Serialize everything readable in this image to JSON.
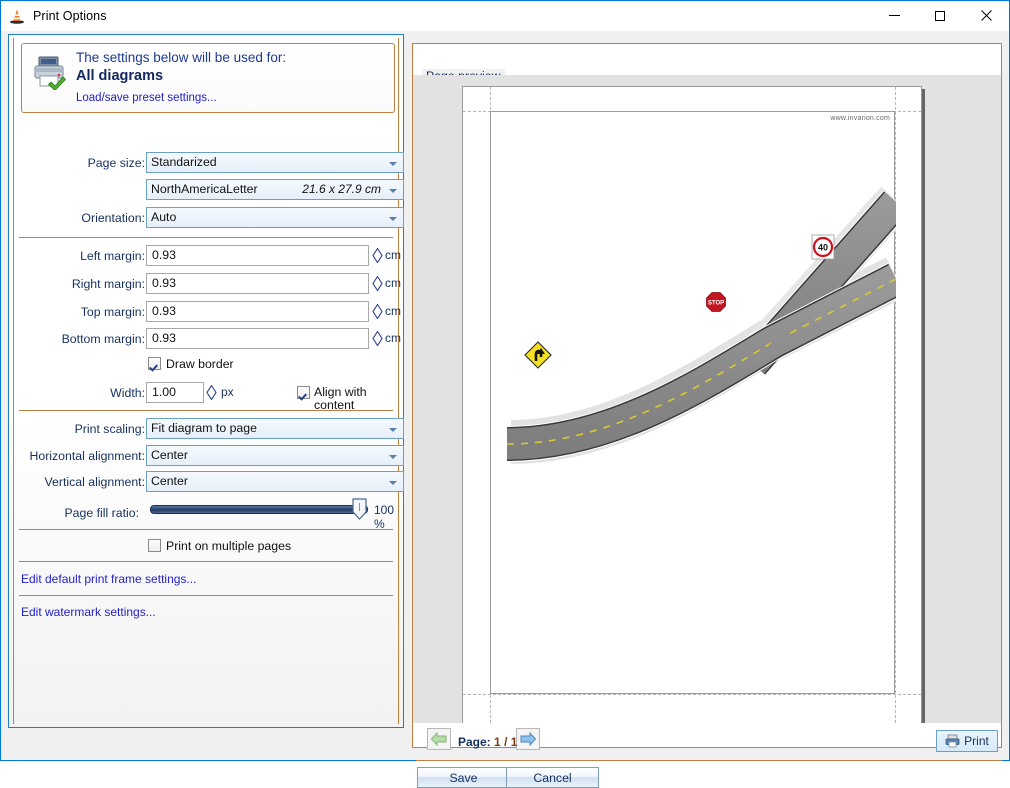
{
  "window": {
    "title": "Print Options",
    "icon": "traffic-cone-icon",
    "minimize_label": "Minimize",
    "maximize_label": "Maximize",
    "close_label": "Close"
  },
  "preset": {
    "icon": "printer-check-icon",
    "line1": "The settings below will be used for:",
    "line2": "All diagrams",
    "link": "Load/save preset settings..."
  },
  "fields": {
    "page_size_label": "Page size:",
    "page_size_value": "Standarized",
    "paper_value": "NorthAmericaLetter",
    "paper_dimensions": "21.6 x 27.9 cm",
    "orientation_label": "Orientation:",
    "orientation_value": "Auto",
    "left_margin_label": "Left margin:",
    "left_margin_value": "0.93",
    "right_margin_label": "Right margin:",
    "right_margin_value": "0.93",
    "top_margin_label": "Top margin:",
    "top_margin_value": "0.93",
    "bottom_margin_label": "Bottom margin:",
    "bottom_margin_value": "0.93",
    "margin_unit": "cm",
    "draw_border_label": "Draw border",
    "draw_border_checked": true,
    "width_label": "Width:",
    "width_value": "1.00",
    "width_unit": "px",
    "align_with_content_label": "Align with content",
    "align_with_content_checked": true,
    "print_scaling_label": "Print scaling:",
    "print_scaling_value": "Fit diagram to page",
    "horizontal_alignment_label": "Horizontal alignment:",
    "horizontal_alignment_value": "Center",
    "vertical_alignment_label": "Vertical alignment:",
    "vertical_alignment_value": "Center",
    "page_fill_ratio_label": "Page fill ratio:",
    "page_fill_ratio_value": "100 %",
    "page_fill_ratio_percent": 100,
    "print_multiple_pages_label": "Print on multiple pages",
    "print_multiple_pages_checked": false,
    "edit_print_frame_link": "Edit default print frame settings...",
    "edit_watermark_link": "Edit watermark settings..."
  },
  "preview": {
    "caption": "Page preview",
    "watermark": "www.invarion.com",
    "page_label_prefix": "Page:",
    "page_current": "1",
    "page_separator": "/",
    "page_total": "1",
    "prev_page_label": "Previous page",
    "next_page_label": "Next page",
    "print_label": "Print",
    "print_icon": "printer-icon",
    "diagram": {
      "description": "Road junction plan with traffic signs",
      "signs": [
        {
          "type": "stop-sign",
          "text": "STOP"
        },
        {
          "type": "speed-limit-sign",
          "text": "40"
        },
        {
          "type": "curve-warning-sign",
          "text": ""
        }
      ]
    }
  },
  "footer": {
    "save_label": "Save",
    "cancel_label": "Cancel"
  },
  "colors": {
    "window_border": "#0078d7",
    "group_border": "#c08040",
    "panel_border": "#1e7ec8",
    "link": "#2222cc",
    "label": "#16305e",
    "slider_fill": "#2a4773"
  }
}
